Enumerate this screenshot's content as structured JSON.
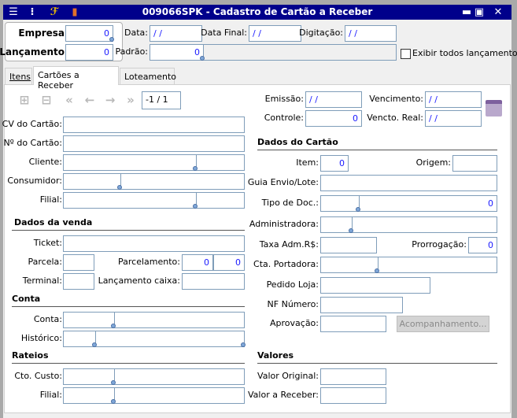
{
  "window": {
    "title": "009066SPK - Cadastro de Cartão a Receber",
    "toolbar_icons": [
      "menu-icon",
      "traffic-light-icon",
      "wrench-icon",
      "book-icon"
    ],
    "controls": [
      "minimize-icon",
      "maximize-icon",
      "close-icon"
    ]
  },
  "header": {
    "empresa_label": "Empresa",
    "empresa_value": "0",
    "lancamento_label": "Lançamento",
    "lancamento_value": "0",
    "data_label": "Data:",
    "data_value": "/ /",
    "data_final_label": "Data Final:",
    "data_final_value": "/ /",
    "digitacao_label": "Digitação:",
    "digitacao_value": "/ /",
    "padrao_label": "Padrão:",
    "padrao_value": "0",
    "exibir_label": "Exibir todos lançamentos",
    "exibir_checked": false
  },
  "tabs": [
    {
      "label": "Itens"
    },
    {
      "label": "Cartões a Receber",
      "active": true
    },
    {
      "label": "Loteamento"
    }
  ],
  "nav": {
    "record": "-1 / 1"
  },
  "left": {
    "cv": "CV do Cartão:",
    "numero": "Nº do Cartão:",
    "cliente": "Cliente:",
    "consumidor": "Consumidor:",
    "filial": "Filial:",
    "venda_heading": "Dados da venda",
    "ticket": "Ticket:",
    "parcela": "Parcela:",
    "parcelamento": "Parcelamento:",
    "parcelamento_v1": "0",
    "parcelamento_v2": "0",
    "terminal": "Terminal:",
    "lanc_caixa": "Lançamento caixa:",
    "conta_heading": "Conta",
    "conta": "Conta:",
    "historico": "Histórico:",
    "rateios_heading": "Rateios",
    "cto_custo": "Cto. Custo:",
    "rateio_filial": "Filial:"
  },
  "right": {
    "emissao": "Emissão:",
    "emissao_value": "/ /",
    "controle": "Controle:",
    "controle_value": "0",
    "vencimento": "Vencimento:",
    "vencimento_value": "/ /",
    "vencto_real": "Vencto. Real:",
    "vencto_real_value": "/ /",
    "cartao_heading": "Dados do Cartão",
    "item": "Item:",
    "item_value": "0",
    "origem": "Origem:",
    "guia": "Guia Envio/Lote:",
    "tipo_doc": "Tipo de Doc.:",
    "tipo_doc_value": "0",
    "administradora": "Administradora:",
    "taxa": "Taxa Adm.R$:",
    "prorrogacao": "Prorrogação:",
    "prorrogacao_value": "0",
    "cta_portadora": "Cta. Portadora:",
    "pedido_loja": "Pedido Loja:",
    "nf_numero": "NF Número:",
    "aprovacao": "Aprovação:",
    "acompanhamento_button": "Acompanhamento...",
    "valores_heading": "Valores",
    "valor_original": "Valor Original:",
    "valor_receber": "Valor a Receber:"
  },
  "colors": {
    "titlebar": "#00008b",
    "field_text": "#1a1aff",
    "field_border": "#7f9db9"
  }
}
